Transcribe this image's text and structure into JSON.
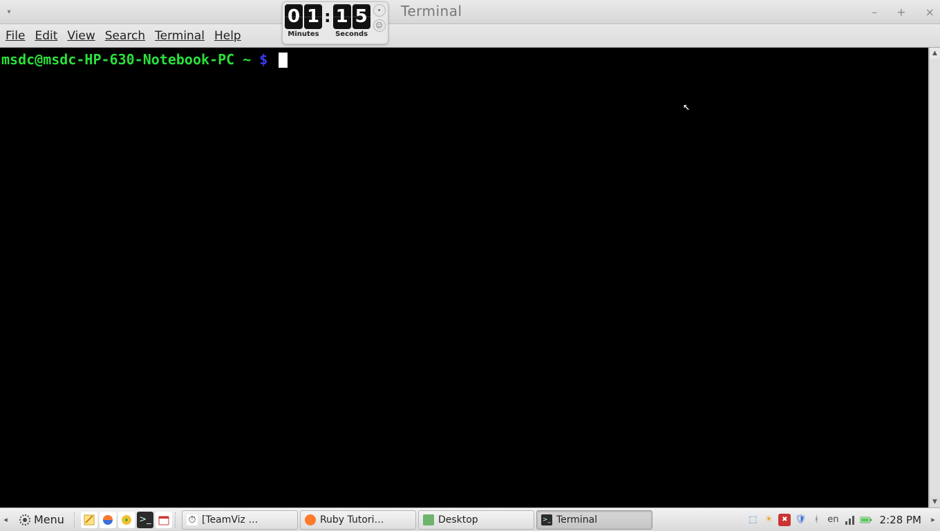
{
  "window": {
    "title": "Terminal",
    "controls": {
      "minimize": "–",
      "maximize": "+",
      "close": "×"
    }
  },
  "menubar": {
    "file": "File",
    "edit": "Edit",
    "view": "View",
    "search": "Search",
    "terminal": "Terminal",
    "help": "Help"
  },
  "timer": {
    "minutes_d1": "0",
    "minutes_d2": "1",
    "seconds_d1": "1",
    "seconds_d2": "5",
    "label_minutes": "Minutes",
    "label_seconds": "Seconds"
  },
  "terminal": {
    "prompt_user": "msdc@msdc-HP-630-Notebook-PC",
    "prompt_sep": " ",
    "prompt_path": "~",
    "prompt_dollar": "$"
  },
  "taskbar": {
    "menu_label": "Menu",
    "tasks": [
      {
        "label": "[TeamViz …",
        "icon_bg": "#ffffff",
        "icon_glyph": "⏱"
      },
      {
        "label": "Ruby Tutori…",
        "icon_bg": "#ff7a2a",
        "icon_glyph": "🦊"
      },
      {
        "label": "Desktop",
        "icon_bg": "#6fb36f",
        "icon_glyph": "▭"
      },
      {
        "label": "Terminal",
        "icon_bg": "#2b2b2b",
        "icon_glyph": ">_"
      }
    ],
    "lang": "en",
    "clock": "2:28 PM"
  }
}
